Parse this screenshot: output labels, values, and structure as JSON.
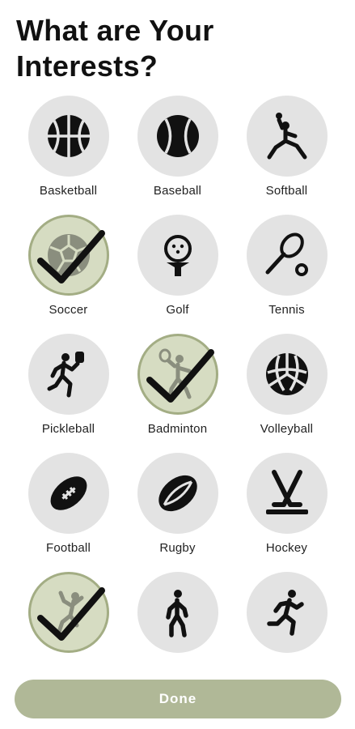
{
  "header": {
    "title_line1": "What are Your",
    "title_line2": "Interests?"
  },
  "sports": [
    {
      "label": "Basketball",
      "icon": "basketball-icon",
      "selected": false
    },
    {
      "label": "Baseball",
      "icon": "baseball-icon",
      "selected": false
    },
    {
      "label": "Softball",
      "icon": "softball-icon",
      "selected": false
    },
    {
      "label": "Soccer",
      "icon": "soccer-icon",
      "selected": true
    },
    {
      "label": "Golf",
      "icon": "golf-icon",
      "selected": false
    },
    {
      "label": "Tennis",
      "icon": "tennis-icon",
      "selected": false
    },
    {
      "label": "Pickleball",
      "icon": "pickleball-icon",
      "selected": false
    },
    {
      "label": "Badminton",
      "icon": "badminton-icon",
      "selected": true
    },
    {
      "label": "Volleyball",
      "icon": "volleyball-icon",
      "selected": false
    },
    {
      "label": "Football",
      "icon": "football-icon",
      "selected": false
    },
    {
      "label": "Rugby",
      "icon": "rugby-icon",
      "selected": false
    },
    {
      "label": "Hockey",
      "icon": "hockey-icon",
      "selected": false
    },
    {
      "label": "",
      "icon": "climbing-icon",
      "selected": true
    },
    {
      "label": "",
      "icon": "walking-icon",
      "selected": false
    },
    {
      "label": "",
      "icon": "running-icon",
      "selected": false
    }
  ],
  "footer": {
    "done_label": "Done"
  },
  "colors": {
    "accent": "#b0b897",
    "selected_fill": "#d6dcc2",
    "selected_border": "#a3ad84",
    "unselected_fill": "#e3e3e3"
  }
}
